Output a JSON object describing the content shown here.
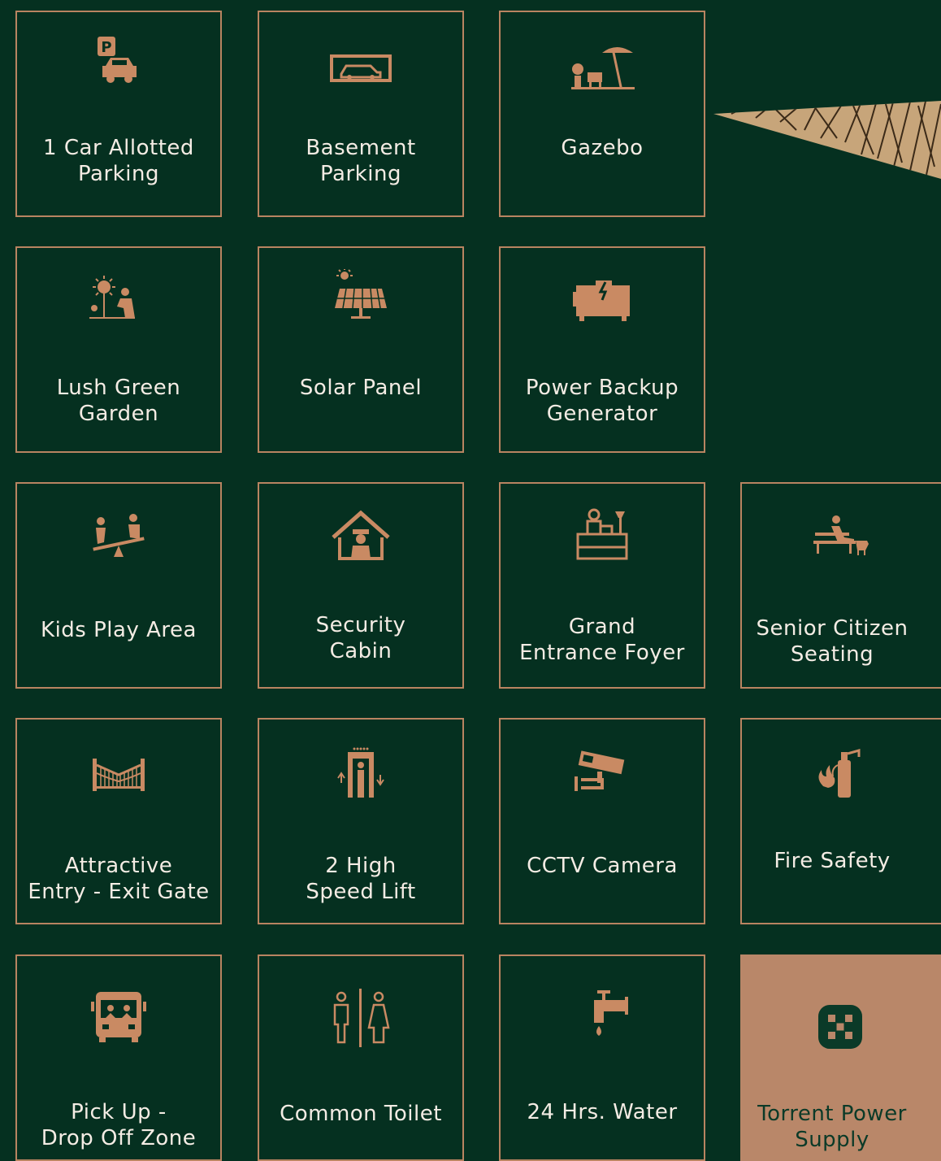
{
  "colors": {
    "background": "#053020",
    "accent": "#b98461",
    "text": "#f4ece4",
    "highlight_fill": "#b98769",
    "highlight_text": "#0b3a28"
  },
  "amenities": [
    {
      "label": "1 Car Allotted\nParking",
      "icon": "parking-car-icon"
    },
    {
      "label": "Basement\nParking",
      "icon": "basement-parking-icon"
    },
    {
      "label": "Gazebo",
      "icon": "gazebo-icon"
    },
    {
      "label": "Lush Green\nGarden",
      "icon": "garden-icon"
    },
    {
      "label": "Solar Panel",
      "icon": "solar-panel-icon"
    },
    {
      "label": "Power Backup\nGenerator",
      "icon": "generator-icon"
    },
    {
      "label": "Kids Play Area",
      "icon": "seesaw-icon"
    },
    {
      "label": "Security\nCabin",
      "icon": "security-cabin-icon"
    },
    {
      "label": "Grand\nEntrance Foyer",
      "icon": "reception-desk-icon"
    },
    {
      "label": "Senior Citizen\nSeating",
      "icon": "bench-icon"
    },
    {
      "label": "Attractive\nEntry - Exit Gate",
      "icon": "gate-icon"
    },
    {
      "label": "2 High\nSpeed Lift",
      "icon": "lift-icon"
    },
    {
      "label": "CCTV Camera",
      "icon": "cctv-camera-icon"
    },
    {
      "label": "Fire Safety",
      "icon": "fire-extinguisher-icon"
    },
    {
      "label": "Pick Up -\nDrop Off Zone",
      "icon": "bus-icon"
    },
    {
      "label": "Common Toilet",
      "icon": "toilet-icon"
    },
    {
      "label": "24 Hrs. Water",
      "icon": "water-tap-icon"
    },
    {
      "label": "Torrent Power\nSupply",
      "icon": "torrent-power-logo-icon"
    }
  ]
}
